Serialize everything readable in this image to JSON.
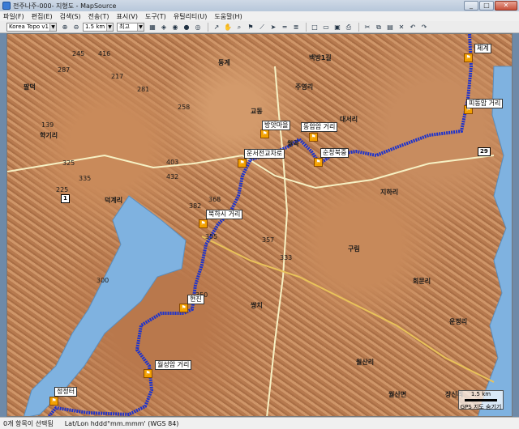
{
  "window": {
    "title": "전주나주-000- 지형도 - MapSource",
    "controls": [
      "_",
      "□",
      "✕"
    ]
  },
  "menu": {
    "items": [
      "파일(F)",
      "편집(E)",
      "검색(S)",
      "전송(T)",
      "표시(V)",
      "도구(T)",
      "유틸리티(U)",
      "도움말(H)"
    ]
  },
  "toolbar": {
    "map_product": "Korea Topo v1",
    "zoom_scale": "1.5 km",
    "detail": "최고"
  },
  "map": {
    "waypoints": [
      {
        "label": "체계",
        "icon": "flag-icon"
      },
      {
        "label": "피동암 거리",
        "icon": "flag-icon"
      },
      {
        "label": "동암암 거리",
        "icon": "flag-icon"
      },
      {
        "label": "순창북중",
        "icon": "flag-icon"
      },
      {
        "label": "방앗마을",
        "icon": "flag-icon"
      },
      {
        "label": "운서전교차로",
        "icon": "flag-icon"
      },
      {
        "label": "북하시 거리",
        "icon": "flag-icon"
      },
      {
        "label": "현진",
        "icon": "flag-icon"
      },
      {
        "label": "월성암 거리",
        "icon": "flag-icon"
      },
      {
        "label": "정정터",
        "icon": "flag-icon"
      }
    ],
    "place_labels": [
      "백방1길",
      "교동",
      "월곡",
      "주영리",
      "대서리",
      "지하리",
      "구림",
      "동계",
      "회문리",
      "월산리",
      "쌍치",
      "운정리",
      "학기리",
      "덕계리",
      "월산면",
      "장신리",
      "팔덕"
    ],
    "road_shields": [
      "1",
      "29"
    ],
    "elevations": [
      "287",
      "139",
      "325",
      "335",
      "368",
      "432",
      "355",
      "382",
      "350",
      "300",
      "225",
      "281",
      "217",
      "258",
      "403",
      "357",
      "333",
      "416",
      "245"
    ],
    "scale_label": "1.5 km",
    "scale_note": "GPS 지도 숨기기"
  },
  "status": {
    "selection": "0개 항목이 선택됨",
    "coords": "Lat/Lon hddd°mm.mmm' (WGS 84)"
  }
}
